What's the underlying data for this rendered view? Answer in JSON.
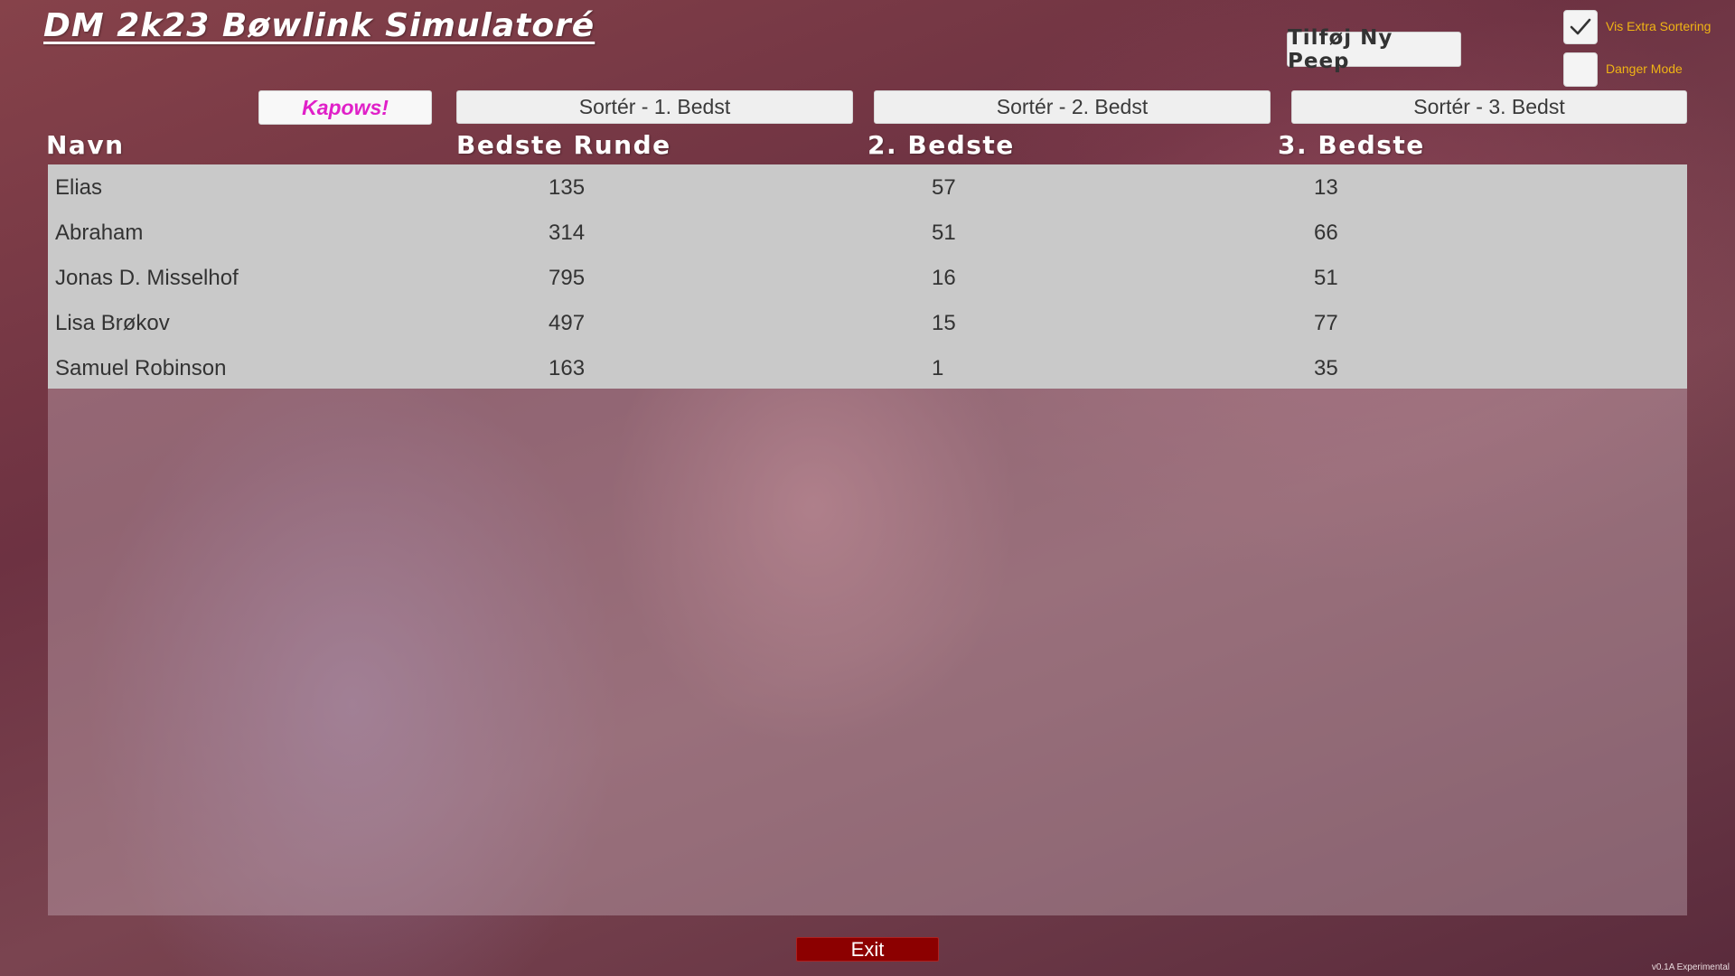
{
  "app": {
    "title": "DM 2k23 Bøwlink Simulatoré",
    "version": "v0.1A Experimental"
  },
  "toolbar": {
    "add_label": "Tilføj Ny Peep",
    "kapows_label": "Kapows!",
    "sort1_label": "Sortér - 1. Bedst",
    "sort2_label": "Sortér - 2. Bedst",
    "sort3_label": "Sortér - 3. Bedst"
  },
  "toggles": {
    "extra_sort": {
      "label": "Vis Extra Sortering",
      "checked": true
    },
    "danger_mode": {
      "label": "Danger Mode",
      "checked": false
    }
  },
  "table": {
    "headers": [
      "Navn",
      "Bedste Runde",
      "2. Bedste",
      "3. Bedste"
    ],
    "rows": [
      {
        "name": "Elias",
        "best": "135",
        "second": "57",
        "third": "13"
      },
      {
        "name": "Abraham",
        "best": "314",
        "second": "51",
        "third": "66"
      },
      {
        "name": "Jonas D. Misselhof",
        "best": "795",
        "second": "16",
        "third": "51"
      },
      {
        "name": "Lisa Brøkov",
        "best": "497",
        "second": "15",
        "third": "77"
      },
      {
        "name": "Samuel Robinson",
        "best": "163",
        "second": "1",
        "third": "35"
      }
    ]
  },
  "footer": {
    "exit_label": "Exit"
  },
  "colors": {
    "accent_magenta": "#e020c8",
    "toggle_label": "#f0b414",
    "exit_red": "#8c0000"
  }
}
